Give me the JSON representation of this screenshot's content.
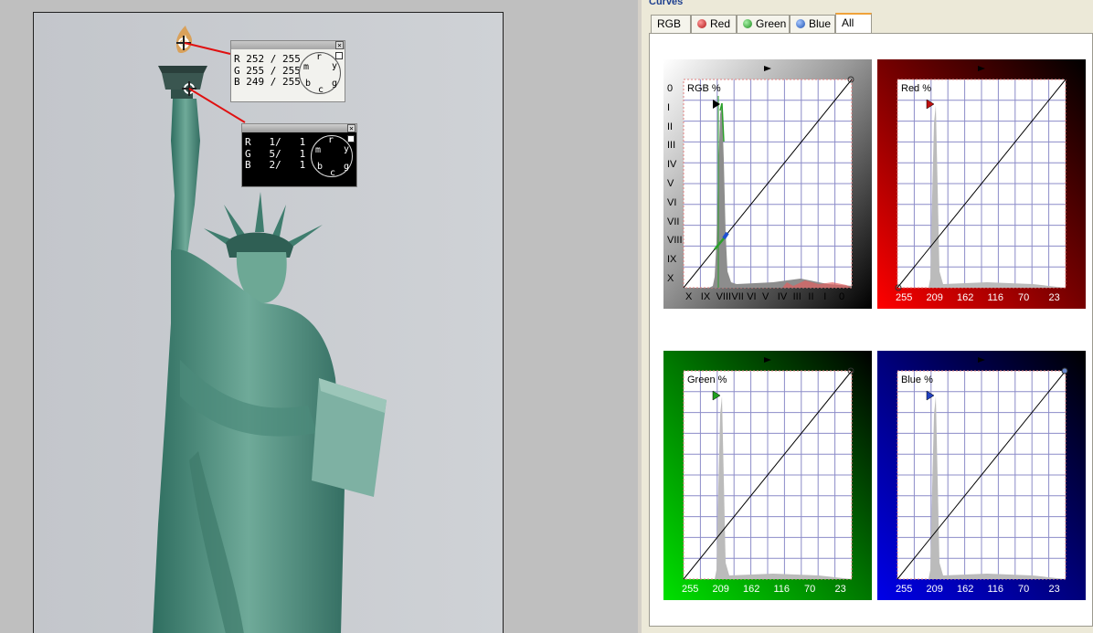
{
  "probe_top": {
    "r": "R 252 / 255",
    "g": "G 255 / 255",
    "b": "B 249 / 255"
  },
  "probe_bottom": {
    "r": "R   1/   1",
    "g": "G   5/   1",
    "b": "B   2/   1"
  },
  "dial_letters": {
    "r": "r",
    "y": "y",
    "g": "g",
    "c": "c",
    "b": "b",
    "m": "m"
  },
  "close_symbol": "✕",
  "curves_panel": {
    "title": "Curves",
    "tabs": [
      {
        "label": "RGB",
        "color": ""
      },
      {
        "label": "Red",
        "color": "#c0262b"
      },
      {
        "label": "Green",
        "color": "#2a9a2a"
      },
      {
        "label": "Blue",
        "color": "#2a5fc0"
      },
      {
        "label": "All",
        "color": ""
      }
    ],
    "active_tab": "All"
  },
  "rgb_curve": {
    "label": "RGB %",
    "y_labels": [
      "0",
      "I",
      "II",
      "III",
      "IV",
      "V",
      "VI",
      "VII",
      "VIII",
      "IX",
      "X"
    ],
    "x_labels": [
      "X",
      "IX",
      "VIII",
      "VII",
      "VI",
      "V",
      "IV",
      "III",
      "II",
      "I",
      "0"
    ]
  },
  "red_curve": {
    "label": "Red %",
    "x_labels": [
      "255",
      "209",
      "162",
      "116",
      "70",
      "23"
    ],
    "accent": "#ff0000"
  },
  "green_curve": {
    "label": "Green %",
    "x_labels": [
      "255",
      "209",
      "162",
      "116",
      "70",
      "23"
    ],
    "accent": "#00c800"
  },
  "blue_curve": {
    "label": "Blue %",
    "x_labels": [
      "255",
      "209",
      "162",
      "116",
      "70",
      "23"
    ],
    "accent": "#0000d0"
  }
}
